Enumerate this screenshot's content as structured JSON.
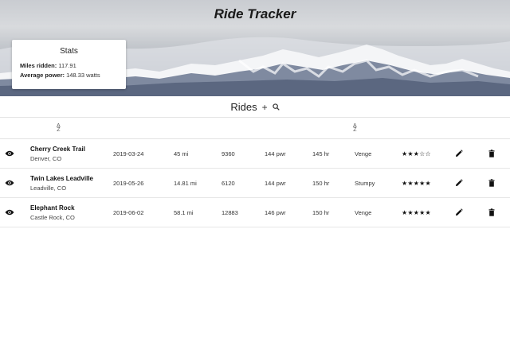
{
  "app": {
    "title": "Ride Tracker"
  },
  "stats": {
    "title": "Stats",
    "miles_label": "Miles ridden:",
    "miles_value": "117.91",
    "power_label": "Average power:",
    "power_value": "148.33 watts"
  },
  "rides_section": {
    "title": "Rides",
    "add_icon": "plus-icon",
    "search_icon": "search-icon",
    "sort_icons": [
      "sort-alpha-icon",
      "sort-alpha-icon"
    ]
  },
  "rides": [
    {
      "name": "Cherry Creek Trail",
      "location": "Denver, CO",
      "date": "2019-03-24",
      "distance": "45 mi",
      "elevation": "9360",
      "power": "144 pwr",
      "hr": "145 hr",
      "bike": "Venge",
      "stars": "★★★☆☆",
      "rating": 3
    },
    {
      "name": "Twin Lakes Leadville",
      "location": "Leadville, CO",
      "date": "2019-05-26",
      "distance": "14.81 mi",
      "elevation": "6120",
      "power": "144 pwr",
      "hr": "150 hr",
      "bike": "Stumpy",
      "stars": "★★★★★",
      "rating": 5
    },
    {
      "name": "Elephant Rock",
      "location": "Castle Rock, CO",
      "date": "2019-06-02",
      "distance": "58.1 mi",
      "elevation": "12883",
      "power": "146 pwr",
      "hr": "150 hr",
      "bike": "Venge",
      "stars": "★★★★★",
      "rating": 5
    }
  ],
  "icons": {
    "view": "eye-icon",
    "edit": "pencil-icon",
    "delete": "trash-icon"
  }
}
